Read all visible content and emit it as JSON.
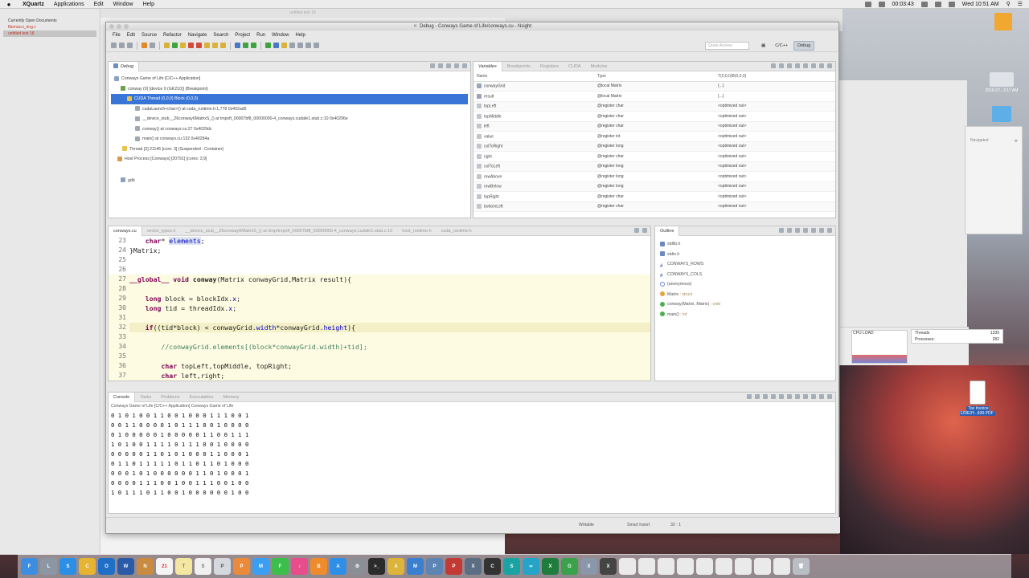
{
  "menubar": {
    "app": "XQuartz",
    "items": [
      "Applications",
      "Edit",
      "Window",
      "Help"
    ],
    "clock_timer": "00:03:43",
    "datetime": "Wed 10:51 AM"
  },
  "bg_window": {
    "title": "untitled text 18",
    "list_header": "Currently Open Documents",
    "docs": [
      "fibonacci_ring.c",
      "untitled text 18"
    ]
  },
  "window": {
    "title": "Debug - Conways Game of Life/conways.cu - Nsight",
    "menu": [
      "File",
      "Edit",
      "Source",
      "Refactor",
      "Navigate",
      "Search",
      "Project",
      "Run",
      "Window",
      "Help"
    ],
    "quick_access": "Quick Access",
    "perspectives": [
      "C/C++",
      "Debug"
    ]
  },
  "debug": {
    "tab": "Debug",
    "rows": [
      "Conways Game of Life [C/C++ Application]",
      "conway (0) [device 0 (GK210)]  (Breakpoint)",
      "CUDA Thread (0,0,0) Block (0,0,0)",
      "cudaLaunch<char>() at cuda_runtime.h:1,778 0x402ad5",
      "__device_stub__Z6conway6MatrixS_() at tmpxft_00007bf8_00000000-4_conways.cudafe1.stub.c:10 0x40296e",
      "conway() at conways.cu:27 0x4029dc",
      "main() at conways.cu:132 0x40284a",
      "Thread [2] 21146 [core: 3] (Suspended : Container)",
      "Host Process [Conways] [20791] [cores: 3,9]",
      "gdb"
    ]
  },
  "variables": {
    "tabs": [
      "Variables",
      "Breakpoints",
      "Registers",
      "CUDA",
      "Modules"
    ],
    "columns": [
      "Name",
      "Type",
      "T(0,0,0)B(0,0,0)"
    ],
    "rows": [
      {
        "name": "conwayGrid",
        "type": "@local Matrix",
        "value": "{...}"
      },
      {
        "name": "result",
        "type": "@local Matrix",
        "value": "{...}"
      },
      {
        "name": "topLeft",
        "type": "@register char",
        "value": "<optimized out>"
      },
      {
        "name": "topMiddle",
        "type": "@register char",
        "value": "<optimized out>"
      },
      {
        "name": "left",
        "type": "@register char",
        "value": "<optimized out>"
      },
      {
        "name": "value",
        "type": "@register int",
        "value": "<optimized out>"
      },
      {
        "name": "colToRight",
        "type": "@register long",
        "value": "<optimized out>"
      },
      {
        "name": "right",
        "type": "@register char",
        "value": "<optimized out>"
      },
      {
        "name": "colToLeft",
        "type": "@register long",
        "value": "<optimized out>"
      },
      {
        "name": "rowAbove",
        "type": "@register long",
        "value": "<optimized out>"
      },
      {
        "name": "rowBelow",
        "type": "@register long",
        "value": "<optimized out>"
      },
      {
        "name": "topRight",
        "type": "@register char",
        "value": "<optimized out>"
      },
      {
        "name": "bottomLeft",
        "type": "@register char",
        "value": "<optimized out>"
      }
    ]
  },
  "editor": {
    "tabs": [
      "conways.cu",
      "vector_types.h",
      "__device_stub__Z6conway6MatrixS_() at /tmp/tmpxft_00007bf8_00000000-4_conways.cudafe1.stub.c:10",
      "host_runtime.h",
      "cuda_runtime.h"
    ],
    "lines": [
      {
        "n": "23",
        "t": "    char* elements;"
      },
      {
        "n": "24",
        "t": "}Matrix;"
      },
      {
        "n": "25",
        "t": ""
      },
      {
        "n": "26",
        "t": ""
      },
      {
        "n": "27",
        "t": "__global__ void conway(Matrix conwayGrid,Matrix result){"
      },
      {
        "n": "28",
        "t": ""
      },
      {
        "n": "29",
        "t": "    long block = blockIdx.x;"
      },
      {
        "n": "30",
        "t": "    long tid = threadIdx.x;"
      },
      {
        "n": "31",
        "t": ""
      },
      {
        "n": "32",
        "t": "    if((tid*block) < conwayGrid.width*conwayGrid.height){"
      },
      {
        "n": "33",
        "t": ""
      },
      {
        "n": "34",
        "t": "        //conwayGrid.elements[(block*conwayGrid.width)+tid];"
      },
      {
        "n": "35",
        "t": ""
      },
      {
        "n": "36",
        "t": "        char topLeft,topMiddle, topRight;"
      },
      {
        "n": "37",
        "t": "        char left,right;"
      }
    ]
  },
  "outline": {
    "tab": "Outline",
    "items": [
      {
        "label": "stdlib.h",
        "type": ""
      },
      {
        "label": "stdio.h",
        "type": ""
      },
      {
        "label": "CONWAYS_ROWS",
        "type": ""
      },
      {
        "label": "CONWAYS_COLS",
        "type": ""
      },
      {
        "label": "{anonymous}",
        "type": ""
      },
      {
        "label": "Matrix",
        "type": ": struct"
      },
      {
        "label": "conway(Matrix, Matrix)",
        "type": ": void"
      },
      {
        "label": "main()",
        "type": ": int"
      }
    ]
  },
  "console": {
    "tabs": [
      "Console",
      "Tasks",
      "Problems",
      "Executables",
      "Memory"
    ],
    "header": "Conways Game of Life [C/C++ Application] Conways Game of Life",
    "rows": [
      "0 1 0 1 0 0 1 1 0 0 1 0 0 0 1 1 1 0 0 1",
      "0 0 1 1 0 0 0 0 1 0 1 1 1 0 0 1 0 0 0 0",
      "0 1 0 0 0 0 0 1 0 0 0 0 0 1 1 0 0 1 1 1",
      "1 0 1 0 0 1 1 1 1 0 1 1 1 0 0 1 0 0 0 0",
      "0 0 0 0 0 1 1 0 1 0 1 0 0 0 1 1 0 0 0 1",
      "0 1 1 0 1 1 1 1 1 0 1 1 0 1 1 0 1 0 0 0",
      "0 0 0 1 0 1 0 0 0 0 0 0 1 1 0 1 0 0 0 1",
      "0 0 0 0 1 1 1 0 0 1 0 0 1 1 1 0 0 1 0 0",
      "1 0 1 1 1 0 1 1 0 0 1 0 0 0 0 0 0 1 0 0"
    ]
  },
  "status": {
    "writable": "Writable",
    "insert": "Smart Insert",
    "pos": "32 : 1"
  },
  "activity": {
    "label": "CPU LOAD",
    "threads_label": "Threads",
    "threads": "1339",
    "processes_label": "Processes:",
    "processes": "282"
  },
  "desktop": {
    "pdf": "Tax Invoice 1Z9E3Y...830.PDF",
    "pdf_date": "2016-07...3:17 AM",
    "panel": "Navigated"
  },
  "dock_apps": [
    "Finder",
    "Launchpad",
    "Safari",
    "Chrome",
    "Outlook",
    "Word",
    "Notes",
    "Calendar",
    "TextEdit",
    "Stickies",
    "Preview",
    "Photos",
    "Messages",
    "FaceTime",
    "iTunes",
    "iBooks",
    "App Store",
    "Settings",
    "Terminal",
    "Arduino",
    "Activity",
    "Postgres",
    "Calculator",
    "Xcode",
    "Console",
    "Skype",
    "Finder2",
    "Excel",
    "Globe",
    "Xquartz",
    "X11"
  ]
}
